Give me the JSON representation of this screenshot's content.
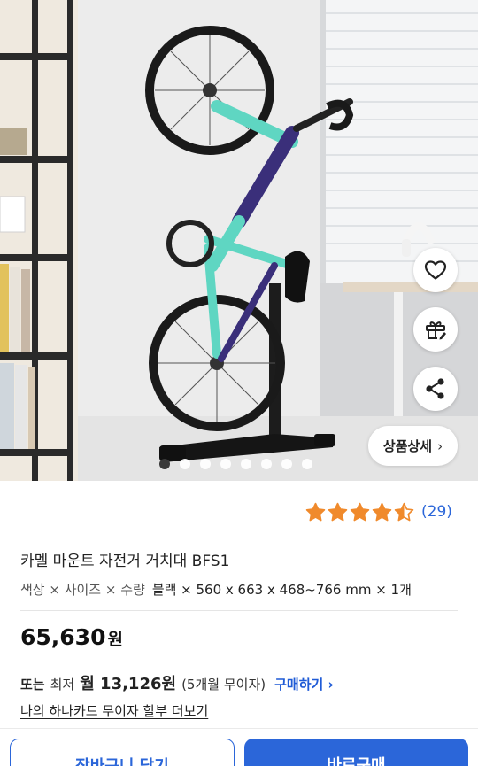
{
  "product": {
    "title": "카멜 마운트 자전거 거치대 BFS1",
    "options_label": "색상 × 사이즈 × 수량",
    "options_value": "블랙 × 560 x 663 x 468~766 mm × 1개",
    "price_number": "65,630",
    "price_unit": "원"
  },
  "rating": {
    "stars": 4.5,
    "max_stars": 5,
    "count_text": "(29)",
    "star_color": "#f08a2c"
  },
  "installment": {
    "lead": "또는",
    "min_label": "최저",
    "amount": "월 13,126원",
    "months": "(5개월 무이자)",
    "buy_link": "구매하기 ›"
  },
  "card_link": "나의 하나카드 무이자 할부 더보기",
  "gallery": {
    "detail_button": "상품상세",
    "detail_chevron": "›",
    "dot_count": 8,
    "active_index": 0,
    "side_buttons": [
      "heart-icon",
      "gift-icon",
      "share-icon"
    ]
  },
  "buttons": {
    "cart": "장바구니 담기",
    "buy": "바로구매"
  },
  "colors": {
    "accent": "#2b66d9",
    "frame_mint": "#5fd6c2",
    "frame_navy": "#3a2f7a"
  }
}
